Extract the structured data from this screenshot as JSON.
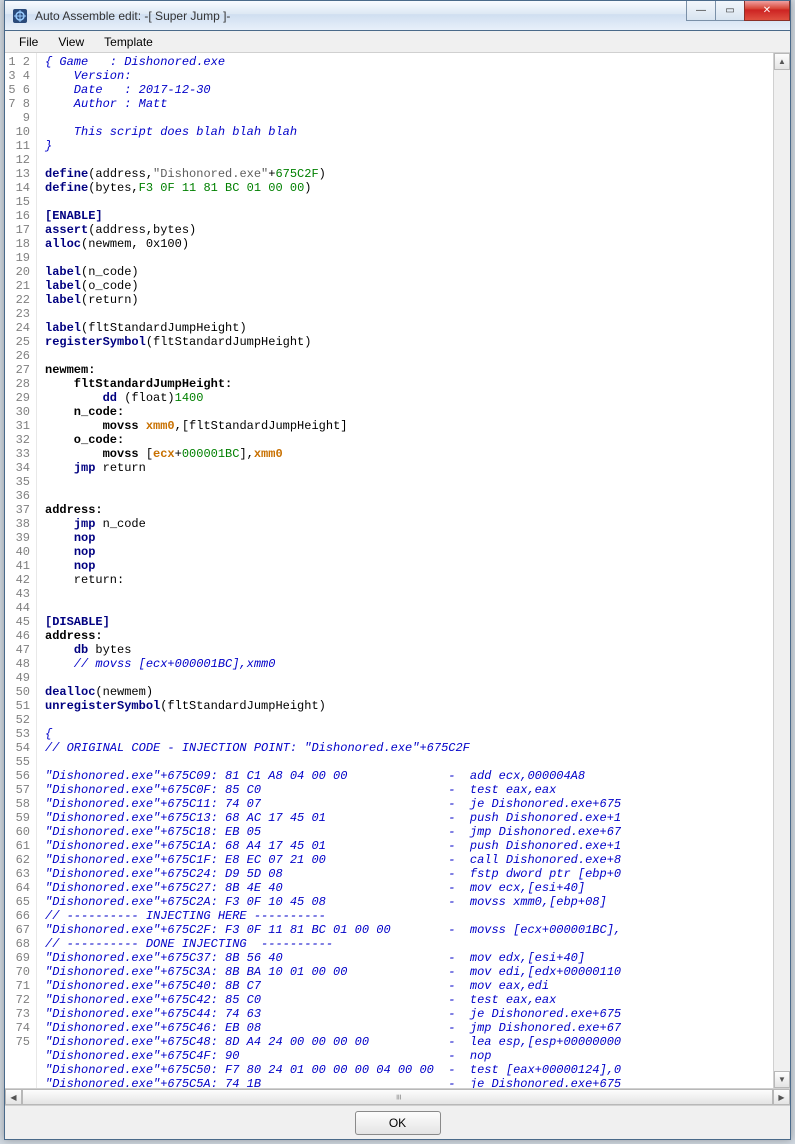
{
  "window": {
    "title": "Auto Assemble edit: -[  Super Jump  ]-"
  },
  "menu": {
    "file": "File",
    "view": "View",
    "template": "Template"
  },
  "footer": {
    "ok": "OK"
  },
  "winbuttons": {
    "min": "—",
    "max": "▭",
    "close": "✕"
  },
  "code": {
    "lines": [
      [
        [
          "cmt",
          "{ Game   : Dishonored.exe"
        ]
      ],
      [
        [
          "cmt",
          "    Version:"
        ]
      ],
      [
        [
          "cmt",
          "    Date   : 2017-12-30"
        ]
      ],
      [
        [
          "cmt",
          "    Author : Matt"
        ]
      ],
      [
        [
          "cmt",
          ""
        ]
      ],
      [
        [
          "cmt",
          "    This script does blah blah blah"
        ]
      ],
      [
        [
          "cmt",
          "}"
        ]
      ],
      [
        [
          "",
          ""
        ]
      ],
      [
        [
          "kw",
          "define"
        ],
        [
          "",
          "(address,"
        ],
        [
          "str",
          "\"Dishonored.exe\""
        ],
        [
          "",
          "+"
        ],
        [
          "num",
          "675C2F"
        ],
        [
          "",
          ")"
        ]
      ],
      [
        [
          "kw",
          "define"
        ],
        [
          "",
          "(bytes,"
        ],
        [
          "num",
          "F3 0F 11 81 BC 01 00 00"
        ],
        [
          "",
          ")"
        ]
      ],
      [
        [
          "",
          ""
        ]
      ],
      [
        [
          "sect",
          "[ENABLE]"
        ]
      ],
      [
        [
          "kw",
          "assert"
        ],
        [
          "",
          "(address,bytes)"
        ]
      ],
      [
        [
          "kw",
          "alloc"
        ],
        [
          "",
          "(newmem, 0x100)"
        ]
      ],
      [
        [
          "",
          ""
        ]
      ],
      [
        [
          "kw",
          "label"
        ],
        [
          "",
          "(n_code)"
        ]
      ],
      [
        [
          "kw",
          "label"
        ],
        [
          "",
          "(o_code)"
        ]
      ],
      [
        [
          "kw",
          "label"
        ],
        [
          "",
          "(return)"
        ]
      ],
      [
        [
          "",
          ""
        ]
      ],
      [
        [
          "kw",
          "label"
        ],
        [
          "",
          "(fltStandardJumpHeight)"
        ]
      ],
      [
        [
          "kw",
          "registerSymbol"
        ],
        [
          "",
          "(fltStandardJumpHeight)"
        ]
      ],
      [
        [
          "",
          ""
        ]
      ],
      [
        [
          "bold",
          "newmem:"
        ]
      ],
      [
        [
          "bold",
          "    fltStandardJumpHeight:"
        ]
      ],
      [
        [
          "",
          "        "
        ],
        [
          "kw",
          "dd"
        ],
        [
          "",
          " (float)"
        ],
        [
          "num",
          "1400"
        ]
      ],
      [
        [
          "bold",
          "    n_code:"
        ]
      ],
      [
        [
          "",
          "        "
        ],
        [
          "bold",
          "movss "
        ],
        [
          "reg",
          "xmm0"
        ],
        [
          "",
          ",[fltStandardJumpHeight]"
        ]
      ],
      [
        [
          "bold",
          "    o_code:"
        ]
      ],
      [
        [
          "",
          "        "
        ],
        [
          "bold",
          "movss"
        ],
        [
          "",
          " ["
        ],
        [
          "reg",
          "ecx"
        ],
        [
          "",
          "+"
        ],
        [
          "num",
          "000001BC"
        ],
        [
          "",
          "],"
        ],
        [
          "reg",
          "xmm0"
        ]
      ],
      [
        [
          "",
          "    "
        ],
        [
          "kw",
          "jmp"
        ],
        [
          "",
          " return"
        ]
      ],
      [
        [
          "",
          ""
        ]
      ],
      [
        [
          "",
          ""
        ]
      ],
      [
        [
          "bold",
          "address:"
        ]
      ],
      [
        [
          "",
          "    "
        ],
        [
          "kw",
          "jmp"
        ],
        [
          "",
          " n_code"
        ]
      ],
      [
        [
          "",
          "    "
        ],
        [
          "kw",
          "nop"
        ]
      ],
      [
        [
          "",
          "    "
        ],
        [
          "kw",
          "nop"
        ]
      ],
      [
        [
          "",
          "    "
        ],
        [
          "kw",
          "nop"
        ]
      ],
      [
        [
          "",
          "    return:"
        ]
      ],
      [
        [
          "",
          ""
        ]
      ],
      [
        [
          "",
          ""
        ]
      ],
      [
        [
          "sect",
          "[DISABLE]"
        ]
      ],
      [
        [
          "bold",
          "address:"
        ]
      ],
      [
        [
          "",
          "    "
        ],
        [
          "kw",
          "db"
        ],
        [
          "",
          " bytes"
        ]
      ],
      [
        [
          "cmt",
          "    // movss [ecx+000001BC],xmm0"
        ]
      ],
      [
        [
          "",
          ""
        ]
      ],
      [
        [
          "kw",
          "dealloc"
        ],
        [
          "",
          "(newmem)"
        ]
      ],
      [
        [
          "kw",
          "unregisterSymbol"
        ],
        [
          "",
          "(fltStandardJumpHeight)"
        ]
      ],
      [
        [
          "",
          ""
        ]
      ],
      [
        [
          "cmt",
          "{"
        ]
      ],
      [
        [
          "cmt",
          "// ORIGINAL CODE - INJECTION POINT: \"Dishonored.exe\"+675C2F"
        ]
      ],
      [
        [
          "cmt",
          ""
        ]
      ],
      [
        [
          "cmt",
          "\"Dishonored.exe\"+675C09: 81 C1 A8 04 00 00              -  add ecx,000004A8"
        ]
      ],
      [
        [
          "cmt",
          "\"Dishonored.exe\"+675C0F: 85 C0                          -  test eax,eax"
        ]
      ],
      [
        [
          "cmt",
          "\"Dishonored.exe\"+675C11: 74 07                          -  je Dishonored.exe+675"
        ]
      ],
      [
        [
          "cmt",
          "\"Dishonored.exe\"+675C13: 68 AC 17 45 01                 -  push Dishonored.exe+1"
        ]
      ],
      [
        [
          "cmt",
          "\"Dishonored.exe\"+675C18: EB 05                          -  jmp Dishonored.exe+67"
        ]
      ],
      [
        [
          "cmt",
          "\"Dishonored.exe\"+675C1A: 68 A4 17 45 01                 -  push Dishonored.exe+1"
        ]
      ],
      [
        [
          "cmt",
          "\"Dishonored.exe\"+675C1F: E8 EC 07 21 00                 -  call Dishonored.exe+8"
        ]
      ],
      [
        [
          "cmt",
          "\"Dishonored.exe\"+675C24: D9 5D 08                       -  fstp dword ptr [ebp+0"
        ]
      ],
      [
        [
          "cmt",
          "\"Dishonored.exe\"+675C27: 8B 4E 40                       -  mov ecx,[esi+40]"
        ]
      ],
      [
        [
          "cmt",
          "\"Dishonored.exe\"+675C2A: F3 0F 10 45 08                 -  movss xmm0,[ebp+08]"
        ]
      ],
      [
        [
          "cmt",
          "// ---------- INJECTING HERE ----------"
        ]
      ],
      [
        [
          "cmt",
          "\"Dishonored.exe\"+675C2F: F3 0F 11 81 BC 01 00 00        -  movss [ecx+000001BC],"
        ]
      ],
      [
        [
          "cmt",
          "// ---------- DONE INJECTING  ----------"
        ]
      ],
      [
        [
          "cmt",
          "\"Dishonored.exe\"+675C37: 8B 56 40                       -  mov edx,[esi+40]"
        ]
      ],
      [
        [
          "cmt",
          "\"Dishonored.exe\"+675C3A: 8B BA 10 01 00 00              -  mov edi,[edx+00000110"
        ]
      ],
      [
        [
          "cmt",
          "\"Dishonored.exe\"+675C40: 8B C7                          -  mov eax,edi"
        ]
      ],
      [
        [
          "cmt",
          "\"Dishonored.exe\"+675C42: 85 C0                          -  test eax,eax"
        ]
      ],
      [
        [
          "cmt",
          "\"Dishonored.exe\"+675C44: 74 63                          -  je Dishonored.exe+675"
        ]
      ],
      [
        [
          "cmt",
          "\"Dishonored.exe\"+675C46: EB 08                          -  jmp Dishonored.exe+67"
        ]
      ],
      [
        [
          "cmt",
          "\"Dishonored.exe\"+675C48: 8D A4 24 00 00 00 00           -  lea esp,[esp+00000000"
        ]
      ],
      [
        [
          "cmt",
          "\"Dishonored.exe\"+675C4F: 90                             -  nop"
        ]
      ],
      [
        [
          "cmt",
          "\"Dishonored.exe\"+675C50: F7 80 24 01 00 00 00 04 00 00  -  test [eax+00000124],0"
        ]
      ],
      [
        [
          "cmt",
          "\"Dishonored.exe\"+675C5A: 74 1B                          -  je Dishonored.exe+675"
        ]
      ],
      [
        [
          "cmt",
          "}"
        ]
      ]
    ]
  }
}
